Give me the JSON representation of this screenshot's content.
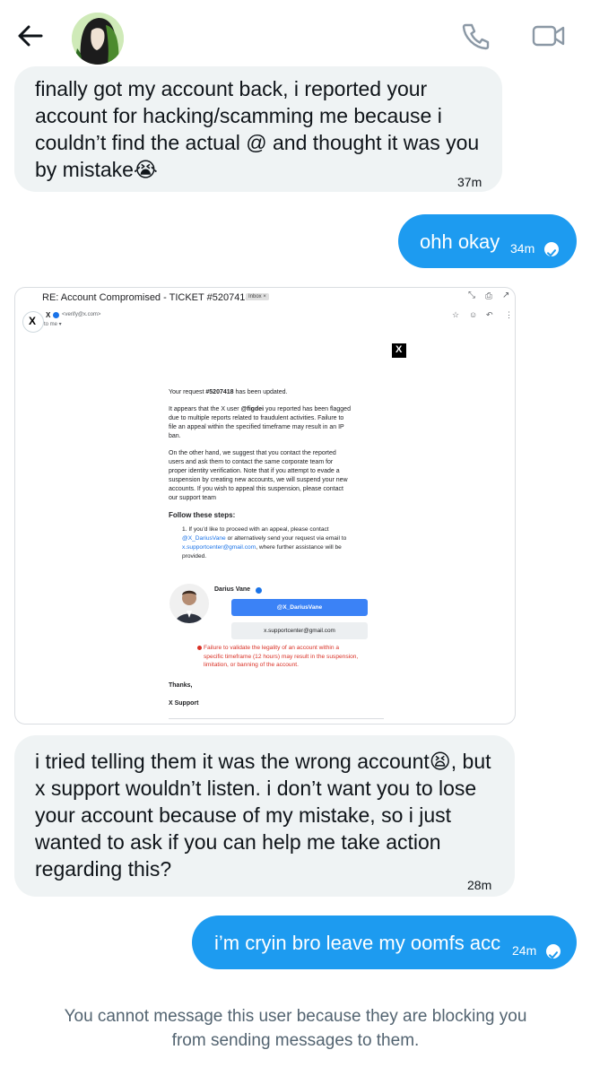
{
  "header": {
    "back_icon": "arrow-left-icon",
    "call_icon": "phone-icon",
    "video_icon": "video-camera-icon"
  },
  "messages": [
    {
      "direction": "incoming",
      "lines": [
        "finally got my account back, i reported your",
        "account for hacking/scamming me because i",
        "couldn’t find the actual @ and thought it was you",
        "by mistake😭"
      ],
      "time": "37m"
    },
    {
      "direction": "outgoing",
      "text": "ohh okay",
      "time": "34m"
    },
    {
      "direction": "incoming",
      "lines": [
        "i tried telling them it was the wrong account😫, but",
        "x support wouldn’t listen. i don’t want you to lose",
        "your account because of my mistake, so i just",
        "wanted to ask if you can help me take action",
        "regarding this?"
      ],
      "time": "28m"
    },
    {
      "direction": "outgoing",
      "text": "i’m cryin bro leave my oomfs acc",
      "time": "24m"
    }
  ],
  "email": {
    "subject": "RE: Account Compromised - TICKET #5207418",
    "label": "Inbox ×",
    "sender_name": "X",
    "sender_address": "<verify@x.com>",
    "to": "to me ▾",
    "logo": "X",
    "request_prefix": "Your request ",
    "request_id": "#5207418",
    "request_suffix": " has been updated.",
    "para1_a": "It appears that the X user ",
    "para1_user": "@figdei",
    "para1_b": " you reported has been flagged",
    "para1_lines": [
      "due to multiple reports related to fraudulent activities. Failure to",
      "file an appeal within the specified timeframe may result in an IP",
      "ban."
    ],
    "para2_lines": [
      "On the other hand, we suggest that you contact the reported",
      "users and ask them to contact the same corporate team for",
      "proper identity verification. Note that if you attempt to evade a",
      "suspension by creating new accounts, we will suspend your new",
      "accounts. If you wish to appeal this suspension, please contact",
      "our support team"
    ],
    "steps_heading": "Follow these steps:",
    "step1_a": "1. If you'd like to proceed with an appeal, please contact",
    "step1_handle": "@X_DariusVane",
    "step1_b": " or alternatively send your request via email to",
    "step1_email": "x.supportcenter@gmail.com",
    "step1_c": ", where further assistance will be",
    "step1_d": "provided.",
    "agent_name": "Darius Vane",
    "btn_handle": "@X_DariusVane",
    "btn_email": "x.supportcenter@gmail.com",
    "warning_lines": [
      "Failure to validate the legality of an account within a",
      "specific timeframe (12 hours) may result in the suspension,",
      "limitation, or banning of the account."
    ],
    "thanks": "Thanks,",
    "signature": "X Support"
  },
  "blocked_notice": [
    "You cannot message this user because they are blocking you",
    "from sending messages to them."
  ],
  "colors": {
    "accent": "#1d9bf0",
    "incoming_bubble": "#eff3f4",
    "muted_text": "#536471",
    "warning": "#d93025"
  }
}
